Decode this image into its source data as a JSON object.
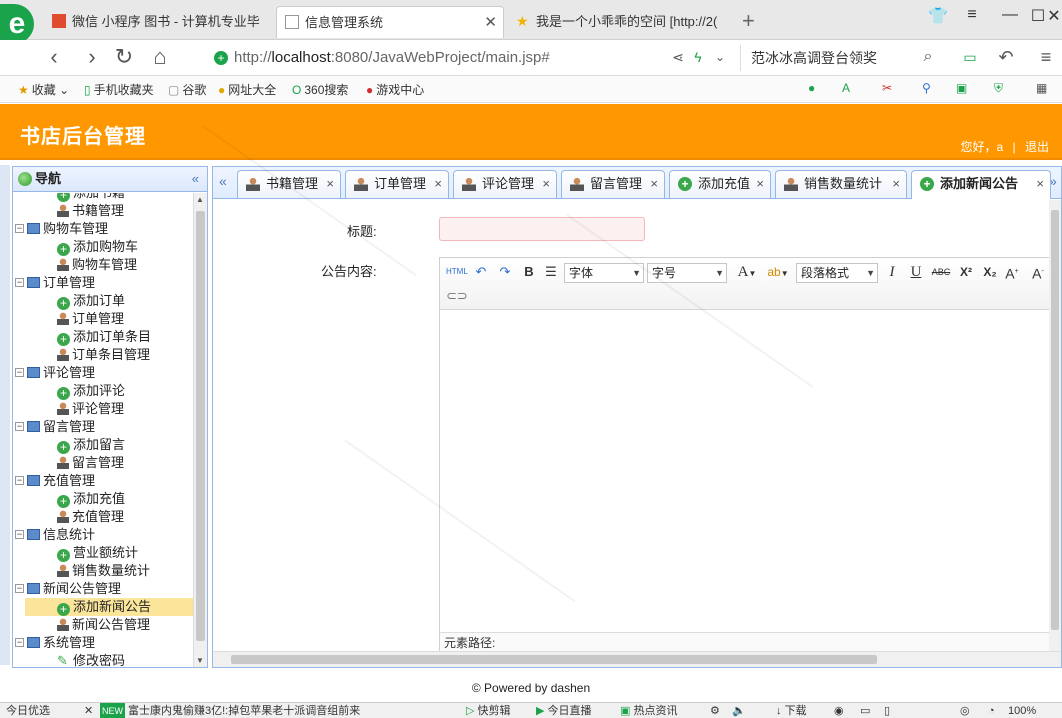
{
  "browser": {
    "tabs": [
      {
        "label": "微信 小程序 图书 - 计算机专业毕"
      },
      {
        "label": "信息管理系统"
      },
      {
        "label": "我是一个小乖乖的空间 [http://2("
      }
    ],
    "new_tab": "+",
    "url_prefix": "http://",
    "url_host": "localhost",
    "url_rest": ":8080/JavaWebProject/main.jsp#",
    "search_text": "范冰冰高调登台领奖",
    "favorites": [
      "收藏",
      "手机收藏夹",
      "谷歌",
      "网址大全",
      "360搜索",
      "游戏中心"
    ]
  },
  "app": {
    "title": "书店后台管理",
    "greeting": "您好，a",
    "separator": "|",
    "logout": "退出"
  },
  "nav": {
    "title": "导航",
    "collapse": "«",
    "nodes": [
      {
        "type": "leaf-add",
        "label": "添加书籍"
      },
      {
        "type": "leaf",
        "label": "书籍管理"
      },
      {
        "type": "group",
        "label": "购物车管理"
      },
      {
        "type": "leaf-add",
        "label": "添加购物车"
      },
      {
        "type": "leaf",
        "label": "购物车管理"
      },
      {
        "type": "group",
        "label": "订单管理"
      },
      {
        "type": "leaf-add",
        "label": "添加订单"
      },
      {
        "type": "leaf",
        "label": "订单管理"
      },
      {
        "type": "leaf-add",
        "label": "添加订单条目"
      },
      {
        "type": "leaf",
        "label": "订单条目管理"
      },
      {
        "type": "group",
        "label": "评论管理"
      },
      {
        "type": "leaf-add",
        "label": "添加评论"
      },
      {
        "type": "leaf",
        "label": "评论管理"
      },
      {
        "type": "group",
        "label": "留言管理"
      },
      {
        "type": "leaf-add",
        "label": "添加留言"
      },
      {
        "type": "leaf",
        "label": "留言管理"
      },
      {
        "type": "group",
        "label": "充值管理"
      },
      {
        "type": "leaf-add",
        "label": "添加充值"
      },
      {
        "type": "leaf",
        "label": "充值管理"
      },
      {
        "type": "group",
        "label": "信息统计"
      },
      {
        "type": "leaf-add",
        "label": "营业额统计"
      },
      {
        "type": "leaf",
        "label": "销售数量统计"
      },
      {
        "type": "group",
        "label": "新闻公告管理"
      },
      {
        "type": "leaf-add",
        "label": "添加新闻公告",
        "selected": true
      },
      {
        "type": "leaf",
        "label": "新闻公告管理"
      },
      {
        "type": "group",
        "label": "系统管理"
      },
      {
        "type": "leaf-pencil",
        "label": "修改密码"
      }
    ]
  },
  "content_tabs": [
    {
      "label": "书籍管理",
      "icon": "person"
    },
    {
      "label": "订单管理",
      "icon": "person"
    },
    {
      "label": "评论管理",
      "icon": "person"
    },
    {
      "label": "留言管理",
      "icon": "person"
    },
    {
      "label": "添加充值",
      "icon": "add"
    },
    {
      "label": "销售数量统计",
      "icon": "person"
    },
    {
      "label": "添加新闻公告",
      "icon": "add",
      "active": true
    }
  ],
  "form": {
    "title_label": "标题:",
    "title_value": "",
    "content_label": "公告内容:",
    "editor": {
      "html_btn": "HTML",
      "bold": "B",
      "font_select": "字体",
      "size_select": "字号",
      "font_color": "A",
      "paragraph_select": "段落格式",
      "italic": "I",
      "underline": "U",
      "strike": "ABC",
      "superscript": "X²",
      "subscript": "X₂",
      "path_label": "元素路径:"
    }
  },
  "footer": {
    "text": "© Powered by dashen"
  },
  "statusbar": {
    "items": [
      "今日优选",
      "NEW",
      "富士康内鬼偷赚3亿!:掉包苹果老十派调音组前来",
      "快剪辑",
      "今日直播",
      "热点资讯",
      "下载",
      "100%"
    ]
  },
  "colors": {
    "header": "#ff9800",
    "nav_border": "#95b8e7",
    "selected": "#fbe59a"
  }
}
